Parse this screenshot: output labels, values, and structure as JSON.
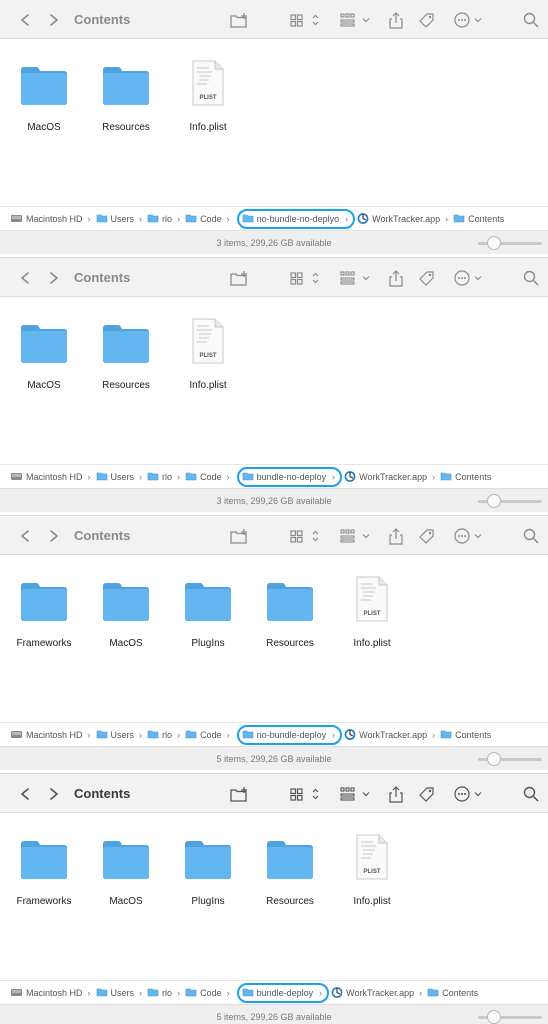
{
  "colors": {
    "folder": "#63b6ef",
    "highlight": "#1aa3e8",
    "toolbar": "#f3f2f2"
  },
  "icons": {
    "back": "chevron-left-icon",
    "forward": "chevron-right-icon",
    "new_folder": "folder-plus-icon",
    "view": "icon-grid-icon",
    "group": "group-list-icon",
    "share": "share-icon",
    "tag": "tag-icon",
    "more": "ellipsis-circle-icon",
    "search": "search-icon"
  },
  "windows": [
    {
      "title": "Contents",
      "items": [
        {
          "label": "MacOS",
          "kind": "folder"
        },
        {
          "label": "Resources",
          "kind": "folder"
        },
        {
          "label": "Info.plist",
          "kind": "plist"
        }
      ],
      "path": [
        "Macintosh HD",
        "Users",
        "rlo",
        "Code",
        "no-bundle-no-deplyo",
        "WorkTracker.app",
        "Contents"
      ],
      "status": "3 items, 299,26 GB available",
      "zoom_level": 0.25
    },
    {
      "title": "Contents",
      "items": [
        {
          "label": "MacOS",
          "kind": "folder"
        },
        {
          "label": "Resources",
          "kind": "folder"
        },
        {
          "label": "Info.plist",
          "kind": "plist"
        }
      ],
      "path": [
        "Macintosh HD",
        "Users",
        "rlo",
        "Code",
        "bundle-no-deploy",
        "WorkTracker.app",
        "Contents"
      ],
      "status": "3 items, 299,26 GB available",
      "zoom_level": 0.25
    },
    {
      "title": "Contents",
      "items": [
        {
          "label": "Frameworks",
          "kind": "folder"
        },
        {
          "label": "MacOS",
          "kind": "folder"
        },
        {
          "label": "PlugIns",
          "kind": "folder"
        },
        {
          "label": "Resources",
          "kind": "folder"
        },
        {
          "label": "Info.plist",
          "kind": "plist"
        }
      ],
      "path": [
        "Macintosh HD",
        "Users",
        "rlo",
        "Code",
        "no-bundle-deploy",
        "WorkTracker.app",
        "Contents"
      ],
      "status": "5 items, 299,26 GB available",
      "zoom_level": 0.25
    },
    {
      "title": "Contents",
      "items": [
        {
          "label": "Frameworks",
          "kind": "folder"
        },
        {
          "label": "MacOS",
          "kind": "folder"
        },
        {
          "label": "PlugIns",
          "kind": "folder"
        },
        {
          "label": "Resources",
          "kind": "folder"
        },
        {
          "label": "Info.plist",
          "kind": "plist"
        }
      ],
      "path": [
        "Macintosh HD",
        "Users",
        "rlo",
        "Code",
        "bundle-deploy",
        "WorkTracker.app",
        "Contents"
      ],
      "status": "5 items, 299,26 GB available",
      "zoom_level": 0.25
    }
  ],
  "plist_badge": "PLIST"
}
